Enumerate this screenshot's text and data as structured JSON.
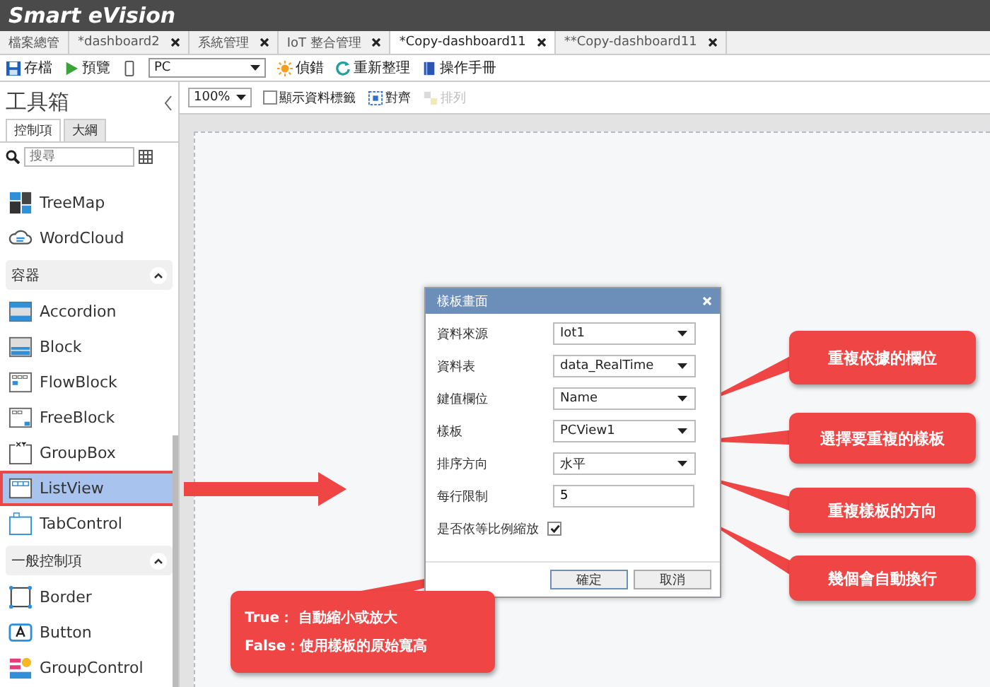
{
  "window": {
    "title": "Smart eVision"
  },
  "tabs": [
    {
      "label": "檔案總管",
      "selected": false,
      "closable": false
    },
    {
      "label": "*dashboard2",
      "selected": false,
      "closable": true
    },
    {
      "label": "系統管理",
      "selected": false,
      "closable": true
    },
    {
      "label": "IoT 整合管理",
      "selected": false,
      "closable": true
    },
    {
      "label": "*Copy-dashboard11",
      "selected": true,
      "closable": true
    },
    {
      "label": "**Copy-dashboard11",
      "selected": false,
      "closable": true
    }
  ],
  "toolbar": [
    {
      "kind": "save",
      "label": "存檔"
    },
    {
      "kind": "preview",
      "label": "預覽"
    },
    {
      "kind": "device",
      "value": "PC"
    },
    {
      "kind": "debug",
      "label": "偵錯"
    },
    {
      "kind": "refresh",
      "label": "重新整理"
    },
    {
      "kind": "manual",
      "label": "操作手冊"
    }
  ],
  "toolbox": {
    "title": "工具箱",
    "tabs": [
      {
        "label": "控制項",
        "selected": true
      },
      {
        "label": "大綱",
        "selected": false
      }
    ],
    "search": {
      "placeholder": "搜尋"
    },
    "lead_items": [
      {
        "kind": "treemap",
        "label": "TreeMap",
        "selected": false
      },
      {
        "kind": "wordcloud",
        "label": "WordCloud",
        "selected": false
      }
    ],
    "sections": [
      {
        "title": "容器",
        "expanded": true,
        "items": [
          {
            "kind": "accordion",
            "label": "Accordion",
            "selected": false
          },
          {
            "kind": "block",
            "label": "Block",
            "selected": false
          },
          {
            "kind": "flowblock",
            "label": "FlowBlock",
            "selected": false
          },
          {
            "kind": "freeblock",
            "label": "FreeBlock",
            "selected": false
          },
          {
            "kind": "groupbox",
            "label": "GroupBox",
            "selected": false
          },
          {
            "kind": "listview",
            "label": "ListView",
            "selected": true
          },
          {
            "kind": "tabcontrol",
            "label": "TabControl",
            "selected": false
          }
        ]
      },
      {
        "title": "一般控制項",
        "expanded": true,
        "items": [
          {
            "kind": "border",
            "label": "Border",
            "selected": false
          },
          {
            "kind": "button",
            "label": "Button",
            "selected": false
          },
          {
            "kind": "groupcontrol",
            "label": "GroupControl",
            "selected": false
          }
        ]
      }
    ]
  },
  "canvas_toolbar": {
    "zoom": "100%",
    "show_labels": {
      "label": "顯示資料標籤",
      "checked": false
    },
    "align": {
      "label": "對齊",
      "disabled": false
    },
    "arrange": {
      "label": "排列",
      "disabled": true
    }
  },
  "dialog": {
    "title": "樣板畫面",
    "fields": [
      {
        "kind": "select",
        "label": "資料來源",
        "value": "Iot1"
      },
      {
        "kind": "select",
        "label": "資料表",
        "value": "data_RealTime"
      },
      {
        "kind": "select",
        "label": "鍵值欄位",
        "value": "Name"
      },
      {
        "kind": "select",
        "label": "樣板",
        "value": "PCView1"
      },
      {
        "kind": "select",
        "label": "排序方向",
        "value": "水平"
      },
      {
        "kind": "input",
        "label": "每行限制",
        "value": "5"
      },
      {
        "kind": "checkbox",
        "label": "是否依等比例縮放",
        "checked": true
      }
    ],
    "buttons": [
      "確定",
      "取消"
    ]
  },
  "callouts": [
    "重複依據的欄位",
    "選擇要重複的樣板",
    "重複樣板的方向",
    "幾個會自動換行"
  ],
  "note": [
    "True： 自動縮小或放大",
    "False：使用樣板的原始寬高"
  ]
}
